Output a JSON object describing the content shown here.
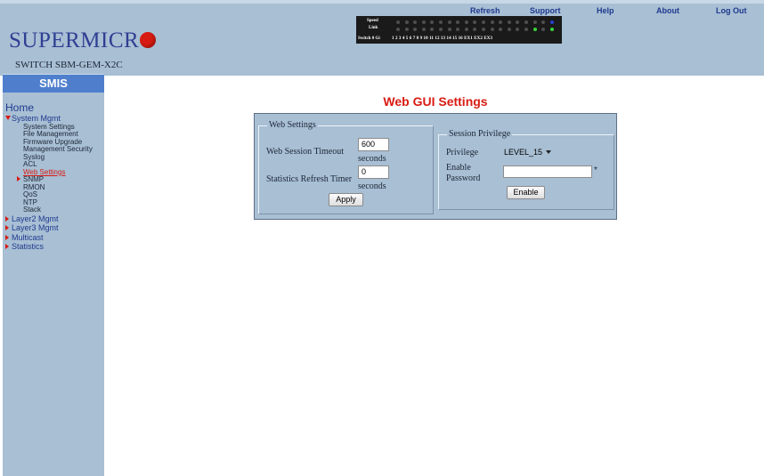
{
  "header": {
    "logo_text": "SUPERMICR",
    "switch_name": "SWITCH SBM-GEM-X2C",
    "nav": {
      "refresh": "Refresh",
      "support": "Support",
      "help": "Help",
      "about": "About",
      "logout": "Log Out"
    },
    "port_panel": {
      "speed_label": "Speed",
      "link_label": "Link",
      "switch_label": "Switch 0 Gi",
      "port_numbers": "1  2  3  4  5  6  7  8  9 10 11 12 13 14 15 16 EX1 EX2 EX3"
    }
  },
  "sidebar": {
    "badge": "SMIS",
    "home": "Home",
    "system_mgmt": "System Mgmt",
    "items": [
      "System Settings",
      "File Management",
      "Firmware Upgrade",
      "Management Security",
      "Syslog",
      "ACL",
      "Web Settings",
      "SNMP",
      "RMON",
      "QoS",
      "NTP",
      "Stack"
    ],
    "selected": "Web Settings",
    "groups": [
      "Layer2 Mgmt",
      "Layer3 Mgmt",
      "Multicast",
      "Statistics"
    ]
  },
  "main": {
    "title": "Web GUI Settings",
    "web_settings": {
      "legend": "Web Settings",
      "timeout_label": "Web Session Timeout",
      "timeout_value": "600",
      "timeout_unit": "seconds",
      "refresh_label": "Statistics Refresh Timer",
      "refresh_value": "0",
      "refresh_unit": "seconds",
      "apply_label": "Apply"
    },
    "session_privilege": {
      "legend": "Session Privilege",
      "privilege_label": "Privilege",
      "privilege_value": "LEVEL_15",
      "enable_label_1": "Enable",
      "enable_label_2": "Password",
      "password_value": "",
      "required_mark": "*",
      "enable_button": "Enable"
    }
  },
  "colors": {
    "header_bg": "#a8bfd4",
    "accent_red": "#d81b12",
    "link_blue": "#1f3a8e",
    "badge_blue": "#4f7fcc",
    "led_off": "#4e4e4e",
    "led_green": "#39d33a",
    "led_blue": "#2a3fd0"
  }
}
